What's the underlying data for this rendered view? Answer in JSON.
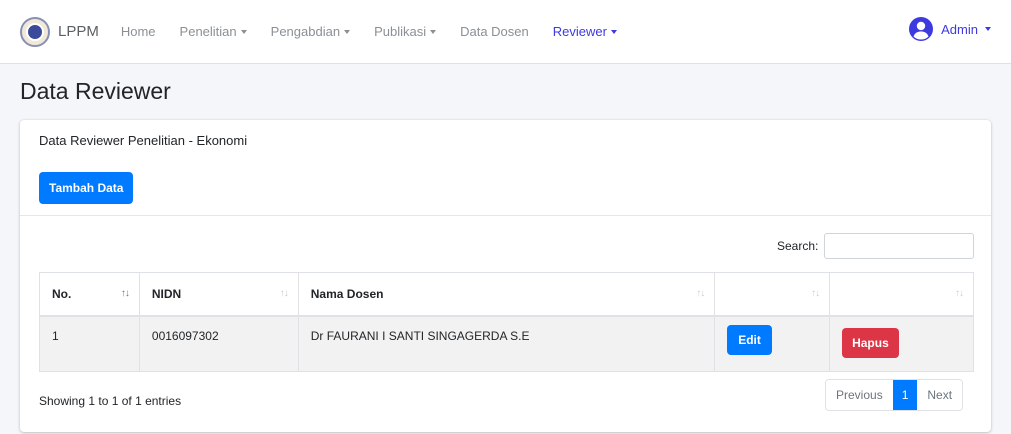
{
  "brand": {
    "name": "LPPM"
  },
  "nav": {
    "items": [
      {
        "label": "Home",
        "dropdown": false
      },
      {
        "label": "Penelitian",
        "dropdown": true
      },
      {
        "label": "Pengabdian",
        "dropdown": true
      },
      {
        "label": "Publikasi",
        "dropdown": true
      },
      {
        "label": "Data Dosen",
        "dropdown": false
      },
      {
        "label": "Reviewer",
        "dropdown": true,
        "active": true
      }
    ]
  },
  "user": {
    "name": "Admin",
    "icon": "user-circle-icon"
  },
  "page": {
    "title": "Data Reviewer"
  },
  "card": {
    "subtitle": "Data Reviewer Penelitian - Ekonomi",
    "add_label": "Tambah Data"
  },
  "search": {
    "label": "Search:",
    "value": ""
  },
  "table": {
    "columns": [
      "No.",
      "NIDN",
      "Nama Dosen",
      "",
      ""
    ],
    "rows": [
      {
        "no": "1",
        "nidn": "0016097302",
        "nama": "Dr FAURANI I SANTI SINGAGERDA S.E",
        "edit": "Edit",
        "hapus": "Hapus"
      }
    ]
  },
  "footer": {
    "info": "Showing 1 to 1 of 1 entries",
    "prev": "Previous",
    "page": "1",
    "next": "Next"
  },
  "colors": {
    "primary": "#007bff",
    "danger": "#dc3545",
    "nav_active": "#3d3ae0"
  }
}
